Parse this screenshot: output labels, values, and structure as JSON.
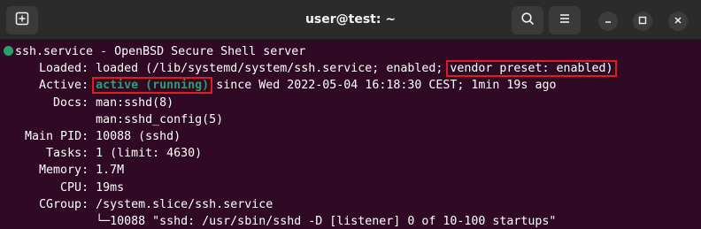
{
  "window": {
    "title": "user@test: ~"
  },
  "icons": {
    "new_tab": "new-tab-icon",
    "search": "search-icon",
    "menu": "hamburger-menu-icon",
    "minimize": "minimize-icon",
    "maximize": "maximize-icon",
    "close": "close-icon"
  },
  "colors": {
    "terminal_bg": "#300a24",
    "active_green": "#26a269",
    "highlight_red": "#e01b24"
  },
  "service": {
    "header": "ssh.service - OpenBSD Secure Shell server",
    "loaded_label": "Loaded:",
    "loaded_value": "loaded (/lib/systemd/system/ssh.service; enabled;",
    "loaded_preset": "vendor preset: enabled)",
    "active_label": "Active:",
    "active_state": "active (running)",
    "active_since": "since Wed 2022-05-04 16:18:30 CEST; 1min 19s ago",
    "docs_label": "Docs:",
    "docs_1": "man:sshd(8)",
    "docs_2": "man:sshd_config(5)",
    "pid_label": "Main PID:",
    "pid_value": "10088 (sshd)",
    "tasks_label": "Tasks:",
    "tasks_value": "1 (limit: 4630)",
    "memory_label": "Memory:",
    "memory_value": "1.7M",
    "cpu_label": "CPU:",
    "cpu_value": "19ms",
    "cgroup_label": "CGroup:",
    "cgroup_value": "/system.slice/ssh.service",
    "cgroup_process": "└─10088 \"sshd: /usr/sbin/sshd -D [listener] 0 of 10-100 startups\""
  }
}
